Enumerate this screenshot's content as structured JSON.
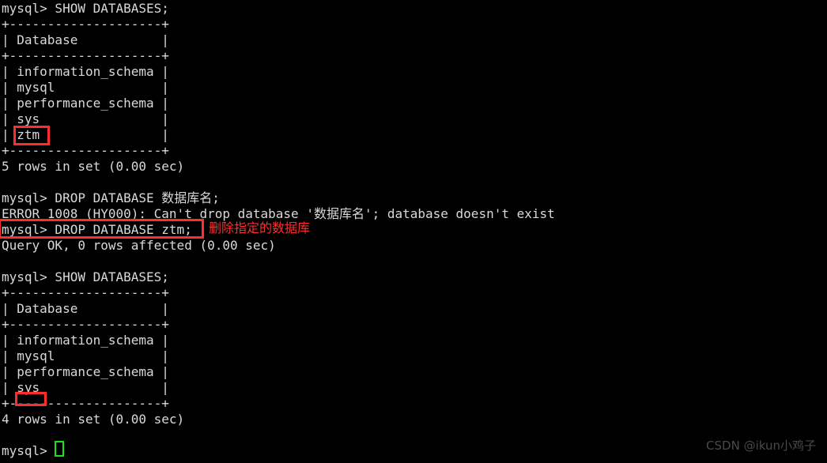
{
  "terminal": {
    "prompt": "mysql>",
    "lines": [
      {
        "text": "mysql> SHOW DATABASES;",
        "kind": "command"
      },
      {
        "text": "+--------------------+",
        "kind": "table-border"
      },
      {
        "text": "| Database           |",
        "kind": "table-header"
      },
      {
        "text": "+--------------------+",
        "kind": "table-border"
      },
      {
        "text": "| information_schema |",
        "kind": "table-row"
      },
      {
        "text": "| mysql              |",
        "kind": "table-row"
      },
      {
        "text": "| performance_schema |",
        "kind": "table-row"
      },
      {
        "text": "| sys                |",
        "kind": "table-row"
      },
      {
        "text": "| ztm                |",
        "kind": "table-row"
      },
      {
        "text": "+--------------------+",
        "kind": "table-border"
      },
      {
        "text": "5 rows in set (0.00 sec)",
        "kind": "status"
      },
      {
        "text": "",
        "kind": "blank"
      },
      {
        "text": "mysql> DROP DATABASE 数据库名;",
        "kind": "command"
      },
      {
        "text": "ERROR 1008 (HY000): Can't drop database '数据库名'; database doesn't exist",
        "kind": "error"
      },
      {
        "text": "mysql> DROP DATABASE ztm;",
        "kind": "command"
      },
      {
        "text": "Query OK, 0 rows affected (0.00 sec)",
        "kind": "status"
      },
      {
        "text": "",
        "kind": "blank"
      },
      {
        "text": "mysql> SHOW DATABASES;",
        "kind": "command"
      },
      {
        "text": "+--------------------+",
        "kind": "table-border"
      },
      {
        "text": "| Database           |",
        "kind": "table-header"
      },
      {
        "text": "+--------------------+",
        "kind": "table-border"
      },
      {
        "text": "| information_schema |",
        "kind": "table-row"
      },
      {
        "text": "| mysql              |",
        "kind": "table-row"
      },
      {
        "text": "| performance_schema |",
        "kind": "table-row"
      },
      {
        "text": "| sys                |",
        "kind": "table-row"
      },
      {
        "text": "+--------------------+",
        "kind": "table-border"
      },
      {
        "text": "4 rows in set (0.00 sec)",
        "kind": "status"
      },
      {
        "text": "",
        "kind": "blank"
      },
      {
        "text": "mysql> ",
        "kind": "prompt"
      }
    ]
  },
  "annotations": {
    "drop_command_note": "删除指定的数据库",
    "highlight_color": "#ff2d2d",
    "cursor_color": "#19e619"
  },
  "watermark": {
    "text": "CSDN @ikun小鸡子",
    "color": "#4a4a4a"
  },
  "colors": {
    "background": "#000000",
    "foreground": "#d9d9d9",
    "accent_red": "#ff2d2d",
    "cursor_green": "#19e619"
  }
}
